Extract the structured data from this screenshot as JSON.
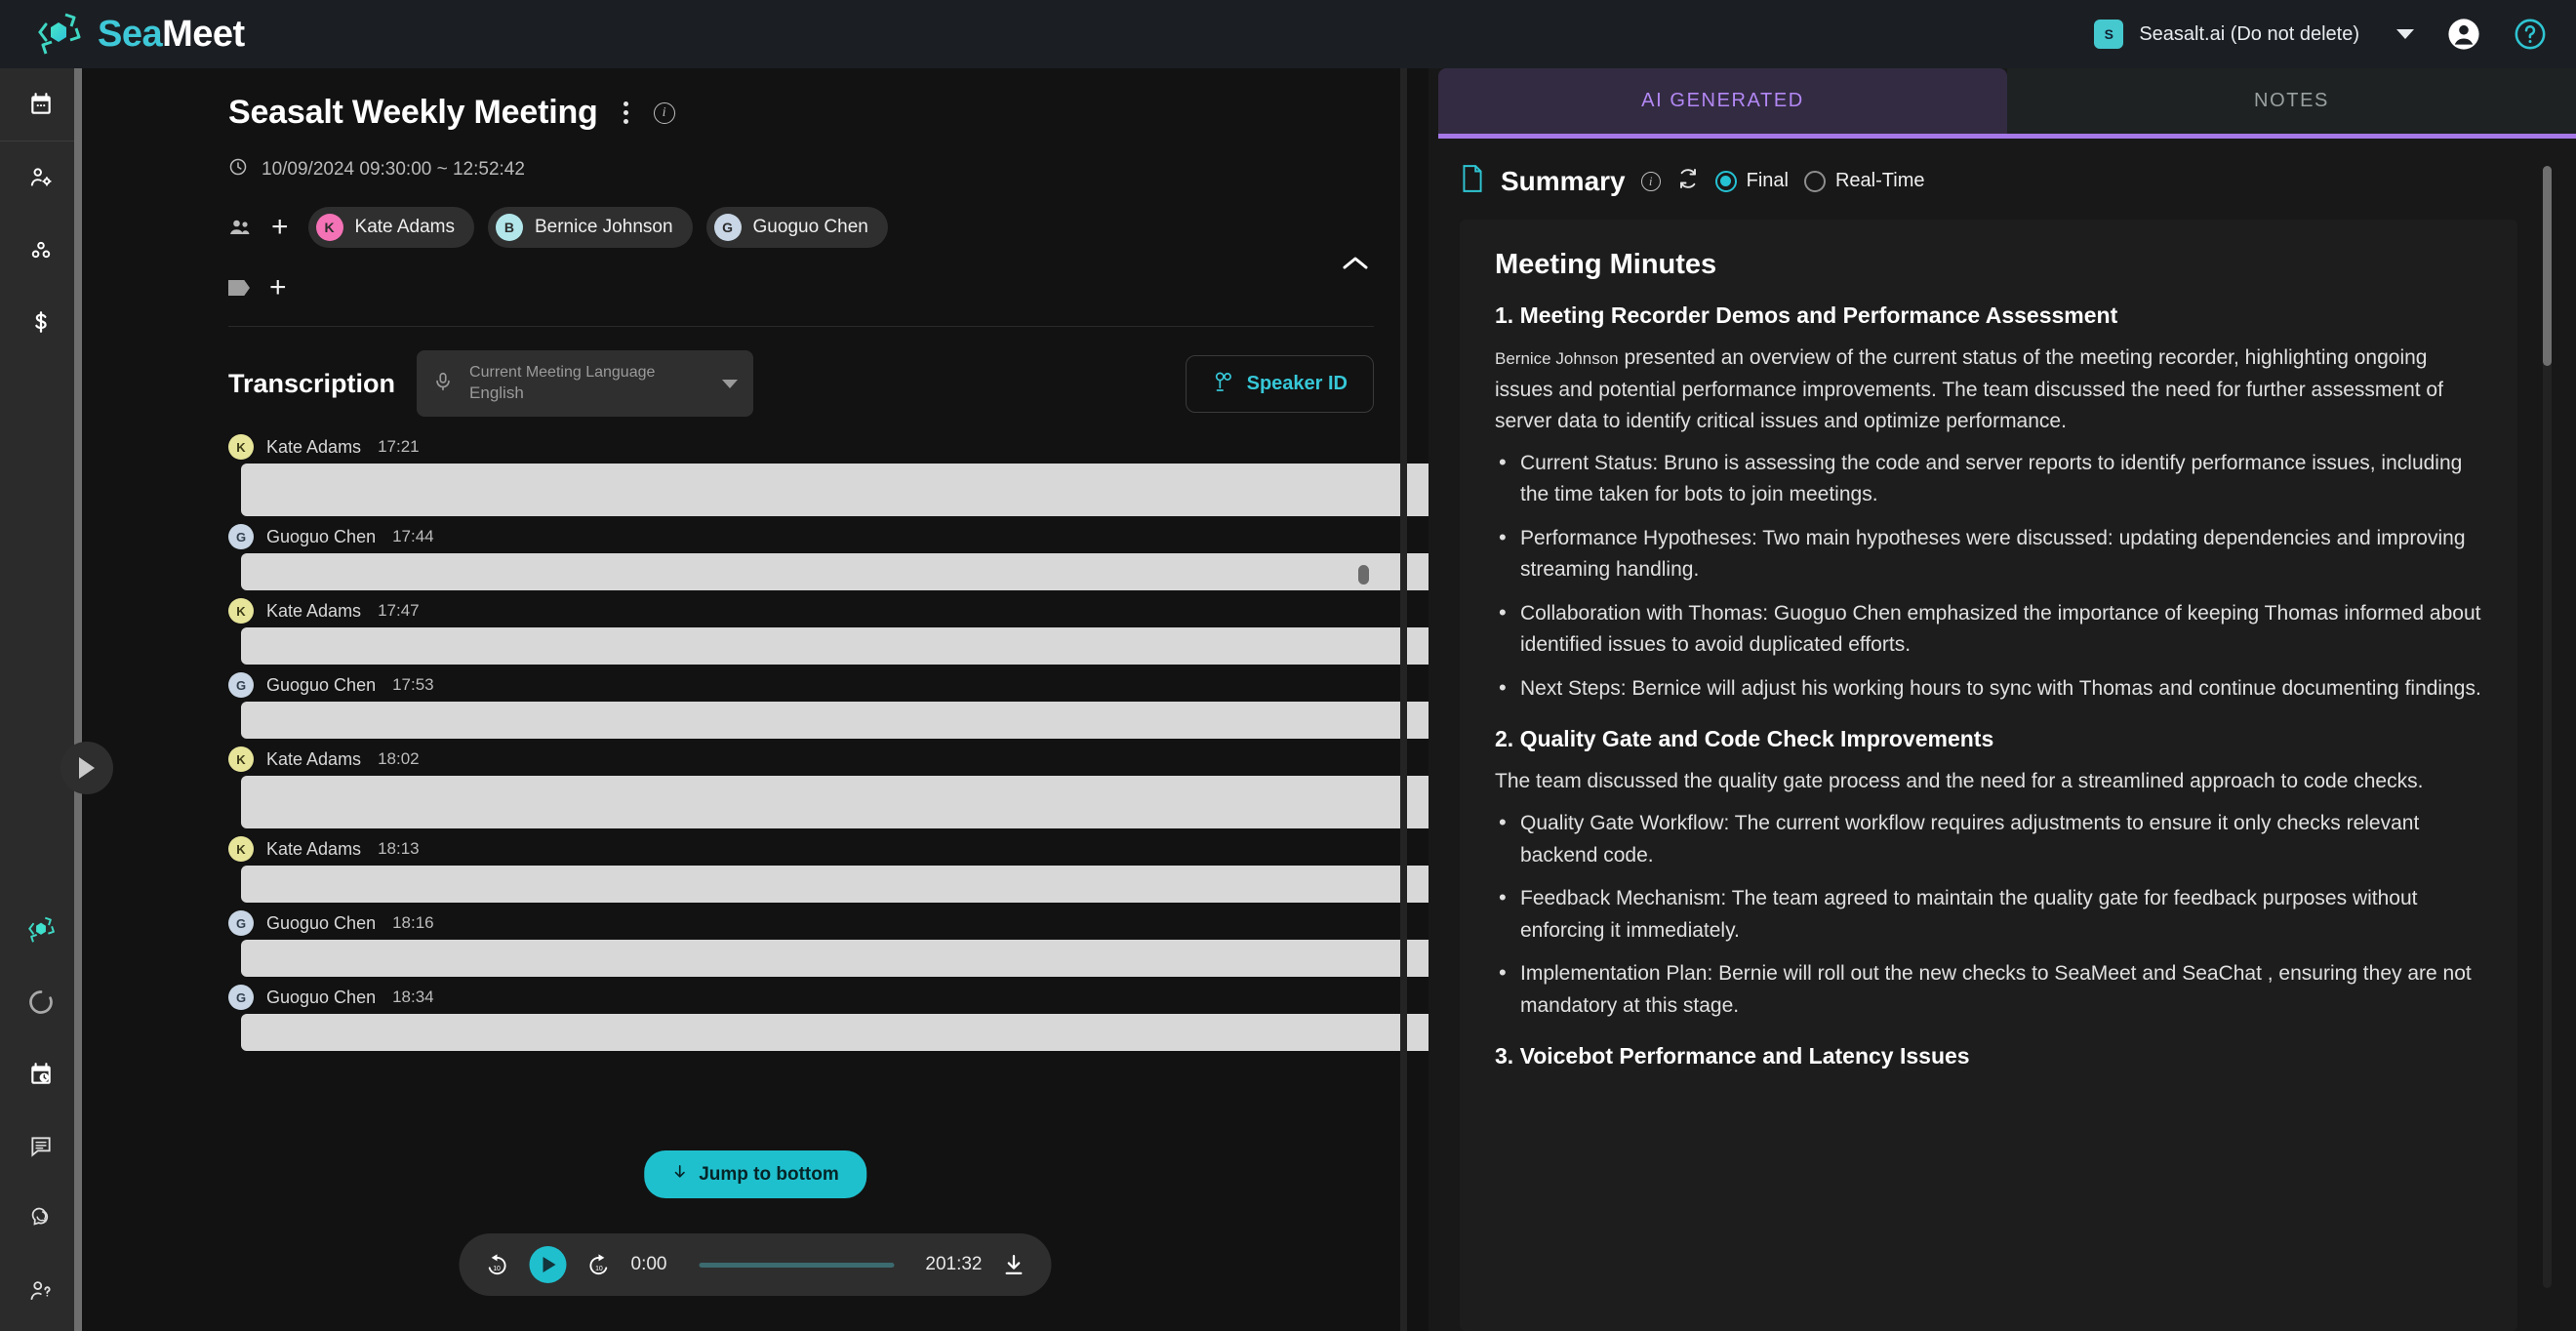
{
  "brand": {
    "name_sea": "Sea",
    "name_meet": "Meet",
    "accent": "#3ec8d8"
  },
  "topbar": {
    "org_initial": "S",
    "org_name": "Seasalt.ai (Do not delete)",
    "account_icon": "account-circle-icon",
    "help_icon": "help-circle-icon",
    "dropdown_icon": "chevron-down-icon"
  },
  "rail": {
    "items": [
      {
        "name": "calendar-icon",
        "label": "Calendar"
      },
      {
        "name": "user-settings-icon",
        "label": "Team Settings"
      },
      {
        "name": "integrations-icon",
        "label": "Integrations"
      },
      {
        "name": "billing-icon",
        "label": "Billing"
      }
    ],
    "bottom_items": [
      {
        "name": "seameet-logo-icon",
        "label": "SeaMeet"
      },
      {
        "name": "circle-loader-icon",
        "label": "Status"
      },
      {
        "name": "calendar-clock-icon",
        "label": "Schedule"
      },
      {
        "name": "notes-icon",
        "label": "Notes"
      },
      {
        "name": "chat-bubble-icon",
        "label": "Chat"
      },
      {
        "name": "user-help-icon",
        "label": "Support"
      }
    ]
  },
  "meeting": {
    "title": "Seasalt Weekly Meeting",
    "time_range": "10/09/2024 09:30:00 ~ 12:52:42",
    "clock_icon": "clock-icon",
    "kebab_icon": "more-vertical-icon",
    "info_icon": "info-icon",
    "collapse_icon": "chevron-up-icon",
    "doc_export_icon": "google-docs-icon",
    "participants_icon": "people-icon",
    "add_participant_label": "+",
    "tag_icon": "tag-icon",
    "add_tag_label": "+",
    "participants": [
      {
        "initial": "K",
        "name": "Kate Adams",
        "color": "#f472b6"
      },
      {
        "initial": "B",
        "name": "Bernice Johnson",
        "color": "#b2e6ea"
      },
      {
        "initial": "G",
        "name": "Guoguo Chen",
        "color": "#c8d6e5"
      }
    ]
  },
  "transcription": {
    "heading": "Transcription",
    "mic_icon": "microphone-icon",
    "language_label": "Current Meeting Language",
    "language_value": "English",
    "language_caret_icon": "chevron-down-icon",
    "speaker_id_label": "Speaker ID",
    "speaker_id_icon": "speaker-id-icon",
    "jump_to_bottom_label": "Jump to bottom",
    "jump_arrow_icon": "arrow-down-icon",
    "entries": [
      {
        "initial": "K",
        "name": "Kate Adams",
        "time": "17:21",
        "color": "#e7e59a",
        "tall": true
      },
      {
        "initial": "G",
        "name": "Guoguo Chen",
        "time": "17:44",
        "color": "#c8d6e5",
        "tall": false
      },
      {
        "initial": "K",
        "name": "Kate Adams",
        "time": "17:47",
        "color": "#e7e59a",
        "tall": false
      },
      {
        "initial": "G",
        "name": "Guoguo Chen",
        "time": "17:53",
        "color": "#c8d6e5",
        "tall": false
      },
      {
        "initial": "K",
        "name": "Kate Adams",
        "time": "18:02",
        "color": "#e7e59a",
        "tall": true
      },
      {
        "initial": "K",
        "name": "Kate Adams",
        "time": "18:13",
        "color": "#e7e59a",
        "tall": false
      },
      {
        "initial": "G",
        "name": "Guoguo Chen",
        "time": "18:16",
        "color": "#c8d6e5",
        "tall": false
      },
      {
        "initial": "G",
        "name": "Guoguo Chen",
        "time": "18:34",
        "color": "#c8d6e5",
        "tall": false
      }
    ]
  },
  "player": {
    "rewind_label": "10",
    "forward_label": "10",
    "rewind_icon": "replay-10-icon",
    "play_icon": "play-icon",
    "forward_icon": "forward-10-icon",
    "current_time": "0:00",
    "total_time": "201:32",
    "download_icon": "download-icon"
  },
  "right_panel": {
    "tabs": [
      {
        "label": "AI GENERATED",
        "active": true
      },
      {
        "label": "NOTES",
        "active": false
      }
    ],
    "summary": {
      "doc_icon": "document-icon",
      "title": "Summary",
      "info_icon": "info-icon",
      "refresh_icon": "refresh-icon",
      "mode_final": "Final",
      "mode_realtime": "Real-Time",
      "selected_mode": "Final"
    },
    "minutes": {
      "title": "Meeting Minutes",
      "sections": [
        {
          "heading": "1. Meeting Recorder Demos and Performance Assessment",
          "intro_name": "Bernice Johnson",
          "intro": " presented an overview of the current status of the meeting recorder, highlighting ongoing issues and potential performance improvements. The team discussed the need for further assessment of server data to identify critical issues and optimize performance.",
          "bullets": [
            "Current Status: Bruno is assessing the code and server reports to identify performance issues, including the time taken for bots to join meetings.",
            "Performance Hypotheses: Two main hypotheses were discussed: updating dependencies and improving streaming handling.",
            "Collaboration with Thomas: Guoguo Chen emphasized the importance of keeping Thomas informed about identified issues to avoid duplicated efforts.",
            "Next Steps: Bernice will adjust his working hours to sync with Thomas and continue documenting findings."
          ]
        },
        {
          "heading": "2. Quality Gate and Code Check Improvements",
          "intro": "The team discussed the quality gate process and the need for a streamlined approach to code checks.",
          "bullets": [
            "Quality Gate Workflow: The current workflow requires adjustments to ensure it only checks relevant backend code.",
            "Feedback Mechanism: The team agreed to maintain the quality gate for feedback purposes without enforcing it immediately.",
            "Implementation Plan: Bernie will roll out the new checks to SeaMeet and SeaChat , ensuring they are not mandatory at this stage."
          ]
        },
        {
          "heading": "3. Voicebot Performance and Latency Issues",
          "intro": "",
          "bullets": []
        }
      ]
    }
  }
}
